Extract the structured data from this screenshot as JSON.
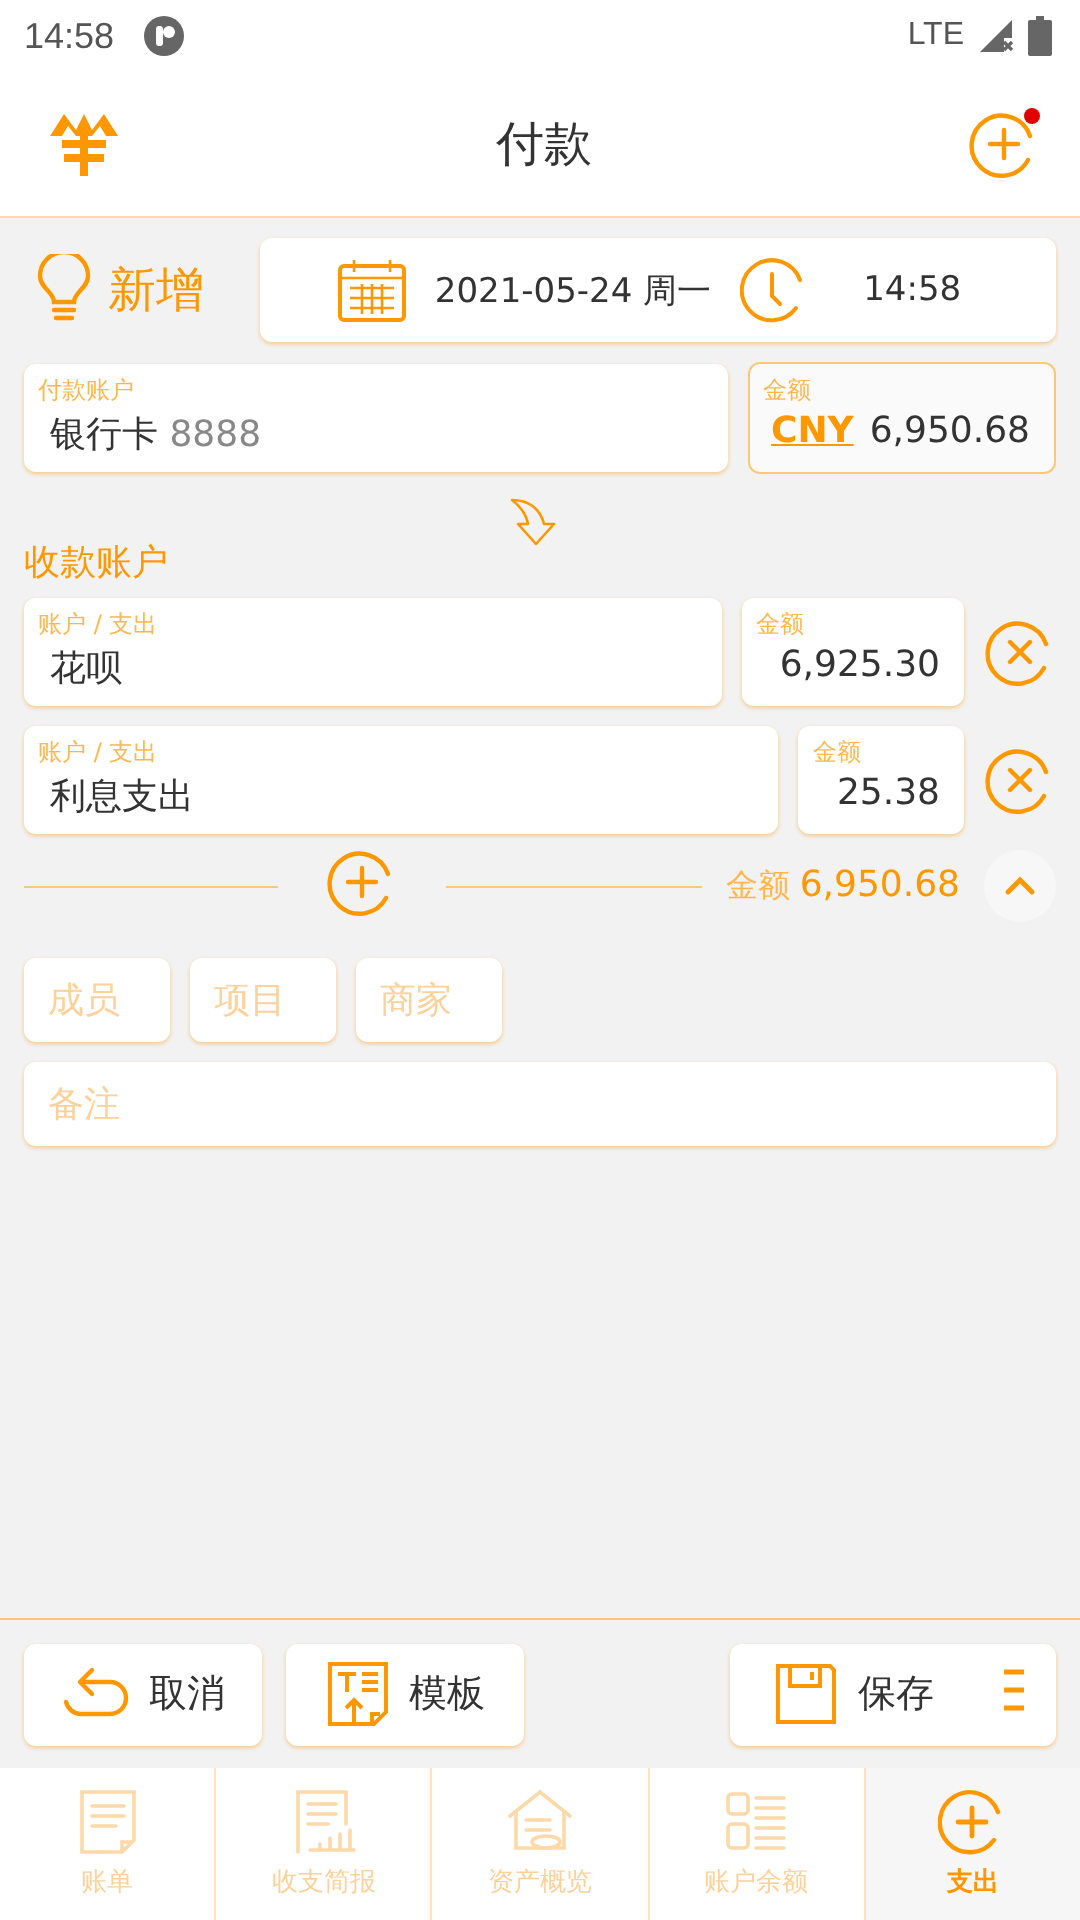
{
  "status_bar": {
    "time": "14:58",
    "network": "LTE"
  },
  "app_bar": {
    "title": "付款",
    "notification_dot": true
  },
  "entry": {
    "mode": "新增",
    "date": "2021-05-24 周一",
    "time": "14:58"
  },
  "payer": {
    "label": "付款账户",
    "account": "银行卡",
    "number": "8888",
    "amount_label": "金额",
    "currency": "CNY",
    "amount": "6,950.68"
  },
  "payee_heading": "收款账户",
  "payees": [
    {
      "label": "账户 / 支出",
      "account": "花呗",
      "amount_label": "金额",
      "amount": "6,925.30"
    },
    {
      "label": "账户 / 支出",
      "account": "利息支出",
      "amount_label": "金额",
      "amount": "25.38"
    }
  ],
  "total": {
    "label": "金额",
    "amount": "6,950.68",
    "expanded": true
  },
  "tags": [
    {
      "placeholder": "成员"
    },
    {
      "placeholder": "项目"
    },
    {
      "placeholder": "商家"
    }
  ],
  "note": {
    "placeholder": "备注"
  },
  "actions": [
    {
      "kind": "cancel",
      "label": "取消"
    },
    {
      "kind": "template",
      "label": "模板"
    },
    {
      "kind": "save",
      "label": "保存"
    }
  ],
  "tabs": [
    {
      "kind": "bill",
      "label": "账单",
      "selected": false
    },
    {
      "kind": "report",
      "label": "收支简报",
      "selected": false
    },
    {
      "kind": "assets",
      "label": "资产概览",
      "selected": false
    },
    {
      "kind": "balance",
      "label": "账户余额",
      "selected": false
    },
    {
      "kind": "expense",
      "label": "支出",
      "selected": true
    }
  ]
}
